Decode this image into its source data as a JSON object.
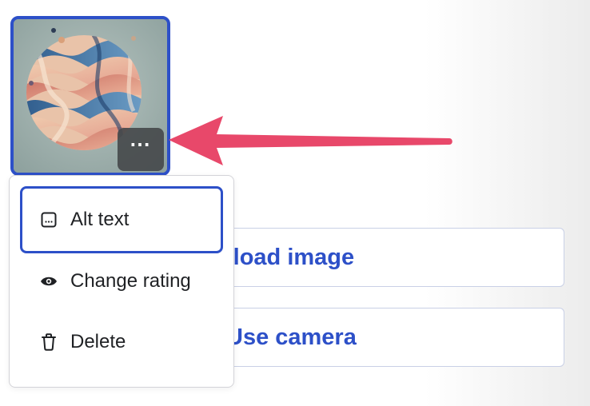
{
  "thumbnail": {
    "more_label": "⋯",
    "border_color": "#2d50c8",
    "more_icon": "ellipsis-icon"
  },
  "annotation": {
    "arrow_color": "#e8486a",
    "icon": "arrow-left-icon"
  },
  "buttons": {
    "upload_label": "Upload image",
    "camera_label": "Use camera",
    "text_color": "#2d50c8"
  },
  "menu": {
    "items": [
      {
        "label": "Alt text",
        "icon": "alt-text-icon",
        "focused": true
      },
      {
        "label": "Change rating",
        "icon": "eye-icon",
        "focused": false
      },
      {
        "label": "Delete",
        "icon": "trash-icon",
        "focused": false
      }
    ]
  }
}
